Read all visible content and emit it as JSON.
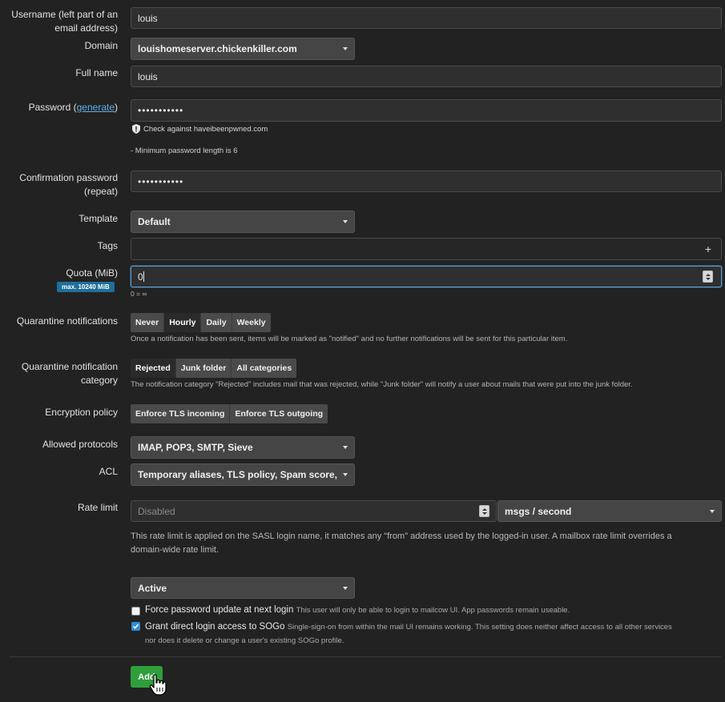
{
  "form": {
    "username": {
      "label": "Username (left part of an email address)",
      "value": "louis"
    },
    "domain": {
      "label": "Domain",
      "value": "louishomeserver.chickenkiller.com"
    },
    "full_name": {
      "label": "Full name",
      "value": "louis"
    },
    "password": {
      "label": "Password (",
      "generate_link": "generate",
      "label_end": ")",
      "value": "•••••••••••",
      "check_text": "Check against haveibeenpwned.com",
      "min_length_text": "- Minimum password length is 6"
    },
    "confirm_password": {
      "label_line1": "Confirmation password",
      "label_line2": "(repeat)",
      "value": "•••••••••••"
    },
    "template": {
      "label": "Template",
      "value": "Default"
    },
    "tags": {
      "label": "Tags",
      "add_symbol": "+"
    },
    "quota": {
      "label": "Quota (MiB)",
      "badge": "max. 10240 MiB",
      "value": "0",
      "help": "0 = ∞"
    },
    "quarantine_notifications": {
      "label": "Quarantine notifications",
      "options": [
        "Never",
        "Hourly",
        "Daily",
        "Weekly"
      ],
      "active": "Hourly",
      "help": "Once a notification has been sent, items will be marked as \"notified\" and no further notifications will be sent for this particular item."
    },
    "quarantine_category": {
      "label_line1": "Quarantine notification",
      "label_line2": "category",
      "options": [
        "Rejected",
        "Junk folder",
        "All categories"
      ],
      "active": "Rejected",
      "help": "The notification category \"Rejected\" includes mail that was rejected, while \"Junk folder\" will notify a user about mails that were put into the junk folder."
    },
    "encryption_policy": {
      "label": "Encryption policy",
      "options": [
        "Enforce TLS incoming",
        "Enforce TLS outgoing"
      ]
    },
    "allowed_protocols": {
      "label": "Allowed protocols",
      "value": "IMAP, POP3, SMTP, Sieve"
    },
    "acl": {
      "label": "ACL",
      "value": "Temporary aliases, TLS policy, Spam score, Bla"
    },
    "rate_limit": {
      "label": "Rate limit",
      "placeholder": "Disabled",
      "unit": "msgs / second",
      "help_line1": "This rate limit is applied on the SASL login name, it matches any \"from\" address used by the logged-in user. A mailbox rate limit overrides a",
      "help_line2": "domain-wide rate limit."
    },
    "status": {
      "value": "Active"
    },
    "force_pw_update": {
      "label": "Force password update at next login",
      "note": "This user will only be able to login to mailcow UI. App passwords remain useable.",
      "checked": false
    },
    "sogo_access": {
      "label": "Grant direct login access to SOGo",
      "note_line1": "Single-sign-on from within the mail UI remains working. This setting does neither affect access to all other services",
      "note_line2": "nor does it delete or change a user's existing SOGo profile.",
      "checked": true
    },
    "add_button": "Add"
  },
  "colors": {
    "background": "#222222",
    "focus_border": "#5a9fd6",
    "quota_badge": "#1f6f9a",
    "check_accent": "#2f8fd6",
    "add_button": "#2e9e3a",
    "link": "#5fb0e8"
  }
}
